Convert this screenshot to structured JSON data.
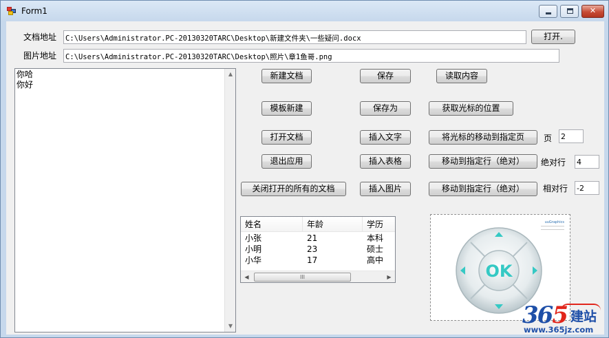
{
  "window": {
    "title": "Form1"
  },
  "title_buttons": {
    "minimize_icon": "minimize-icon",
    "maximize_icon": "maximize-icon",
    "close_icon": "close-icon"
  },
  "doc_path": {
    "label": "文档地址",
    "value": "C:\\Users\\Administrator.PC-20130320TARC\\Desktop\\新建文件夹\\一些疑问.docx"
  },
  "open_button": "打开.",
  "img_path": {
    "label": "图片地址",
    "value": "C:\\Users\\Administrator.PC-20130320TARC\\Desktop\\照片\\章1鱼哥.png"
  },
  "editor": {
    "lines": [
      "你哈",
      "你好"
    ]
  },
  "buttons": {
    "new_doc": "新建文档",
    "save": "保存",
    "read_content": "读取内容",
    "template_new": "模板新建",
    "save_as": "保存为",
    "get_cursor": "获取光标的位置",
    "open_doc": "打开文档",
    "insert_text": "插入文字",
    "move_cursor_page": "将光标的移动到指定页",
    "exit_app": "退出应用",
    "insert_table": "插入表格",
    "move_line_abs": "移动到指定行（绝对）",
    "close_all": "关闭打开的所有的文档",
    "insert_image": "插入图片",
    "move_line_rel": "移动到指定行（绝对）"
  },
  "page_input": {
    "label": "页",
    "value": "2"
  },
  "abs_input": {
    "label": "绝对行",
    "value": "4"
  },
  "rel_input": {
    "label": "相对行",
    "value": "-2"
  },
  "list": {
    "columns": [
      "姓名",
      "年龄",
      "学历"
    ],
    "rows": [
      [
        "小张",
        "21",
        "本科"
      ],
      [
        "小明",
        "23",
        "硕士"
      ],
      [
        "小华",
        "17",
        "高中"
      ]
    ],
    "scroll_thumb": "III"
  },
  "picture": {
    "center_label": "OK",
    "brand_text": "uuGraphics"
  },
  "watermark": {
    "num_a": "36",
    "num_b": "5",
    "cn": "建站",
    "url": "www.365jz.com"
  }
}
